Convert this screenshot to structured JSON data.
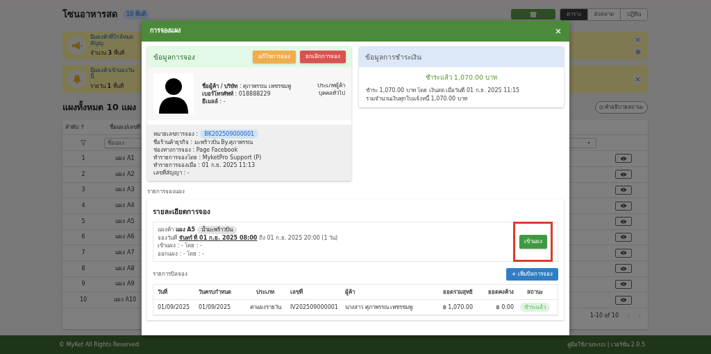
{
  "header": {
    "title": "โซนอาหารสด",
    "badge": "10 พื้นที่",
    "tabs": [
      {
        "label": "ตาราง",
        "selected": true
      },
      {
        "label": "ผังตลาด",
        "selected": false
      },
      {
        "label": "ปฏิทิน",
        "selected": false
      }
    ]
  },
  "alerts": [
    {
      "kind": "megaphone",
      "title": "มีแผงค้าที่ใกล้หมดสัญญ",
      "text": "จำนวน **3** พื้นที่",
      "settings": true
    },
    {
      "kind": "bell",
      "title": "มีแผงค้าเข้าแผงวันนี้",
      "text": "รายวัน **1** พื้นที่",
      "settings": false
    }
  ],
  "stalls_heading": "แผงทั้งหมด 10 แผง",
  "status_help_button": "คำอธิบายสถานะ",
  "table": {
    "columns": [
      "ลำดับ ↑",
      "ชื่อแผง/เลขที่"
    ],
    "filter_placeholder": "ชื่อแผง",
    "rows": [
      {
        "number": "1",
        "name": "แผง A1"
      },
      {
        "number": "2",
        "name": "แผง A2"
      },
      {
        "number": "3",
        "name": "แผง A3"
      },
      {
        "number": "4",
        "name": "แผง A4"
      },
      {
        "number": "5",
        "name": "แผง A5"
      },
      {
        "number": "6",
        "name": "แผง A6"
      },
      {
        "number": "7",
        "name": "แผง A7"
      },
      {
        "number": "8",
        "name": "แผง A8"
      },
      {
        "number": "9",
        "name": "แผง A9"
      },
      {
        "number": "10",
        "name": "แผง A10"
      }
    ],
    "pagination": "1-10 of 10"
  },
  "footer": {
    "copyright": "© MyKet All Rights Reserved",
    "links": "คู่มือใช้งานระบบ | เวอร์ชั่น 2.0.5"
  },
  "modal": {
    "title": "การจองแผง",
    "booking_info": {
      "title": "ข้อมูลการจอง",
      "buttons": [
        {
          "label": "แก้ไขการจอง",
          "kind": "warning"
        },
        {
          "label": "ยกเลิกการจอง",
          "kind": "danger"
        }
      ],
      "customer_lines": [
        "**ชื่อผู้ค้า / บริษัท** : ศุภาพรรณ เพชรชมพู",
        "**เบอร์โทรศัพท์** : 018888229",
        "**อีเมลล์** : -"
      ],
      "customer_type_label": "ประเภทผู้ค้า",
      "customer_type": "บุคคลทั่วไป",
      "booking_number_label": "หมายเลขการจอง :",
      "booking_number": "BK202509000001",
      "details": [
        "ชื่อร้านค้าธุรกิจ : มะพร้าวปั่น By.ศุภาพรรณ",
        "ช่องทางการจอง : Page Facebook",
        "ทำรายการจองโดย : MyketPro Support (P)",
        "ทำรายการจองเมื่อ : 01 ก.ย. 2025 11:13",
        "เลขที่สัญญา : -"
      ]
    },
    "payment_info": {
      "title": "ข้อมูลการชำระเงิน",
      "status": "ชำระแล้ว 1,070.00 บาท",
      "lines": [
        "ชำระ 1,070.00 บาท โดย เงินสด เมื่อวันที่ 01 ก.ย. 2025 11:15",
        "รวมจำนวนเงินทุกใบแจ้งหนี้ 1,070.00 บาท"
      ]
    },
    "section_label": "รายการจองแผง",
    "booking_detail": {
      "title": "รายละเอียดการจอง",
      "stall": "แผงค้า **แผง A5**",
      "product_tag": "น้ำมะพร้าวปั่น",
      "date": "จองวันที่ **จันทร์ ที่ 01 ก.ย. 2025 08:00** ถึง 01 ก.ย. 2025 20:00 (1 วัน)",
      "check_in": "เข้าแผง : - โดย : -",
      "check_out": "ออกแผง : - โดย : -",
      "action_button": "เข้าแผง",
      "annotated": true
    },
    "bills": {
      "title": "รายการบิลจอง",
      "add_button": "+ เพิ่มบิลการจอง",
      "columns": [
        "วันที่",
        "วันครบกำหนด",
        "ประเภท",
        "เลขที่",
        "ผู้ค้า",
        "ยอดรวมสุทธิ",
        "ยอดคงค้าง",
        "สถานะ"
      ],
      "rows": [
        {
          "cells": [
            "01/09/2025",
            "01/09/2025",
            "ค่าแผงรายวัน",
            "IV202509000001",
            "นางสาว ศุภาพรรณ เพชรชมพู",
            "฿ 1,070.00",
            "฿ 0.00"
          ],
          "status": {
            "label": "ชำระแล้ว",
            "kind": "paid"
          }
        }
      ]
    }
  }
}
